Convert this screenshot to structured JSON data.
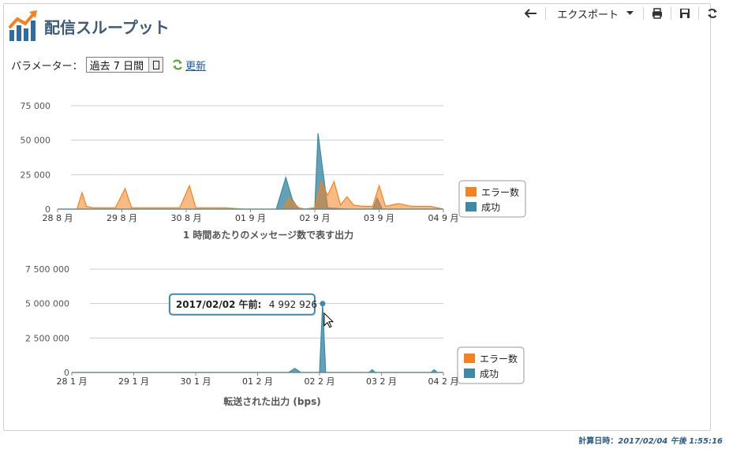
{
  "header": {
    "title": "配信スループット"
  },
  "toolbar": {
    "export_label": "エクスポート"
  },
  "params": {
    "label": "パラメーター：",
    "value": "過去 7 日間",
    "refresh_label": "更新"
  },
  "charts": [
    {
      "caption": "1 時間あたりのメッセージ数で表す出力",
      "y_ticks": [
        "75 000",
        "50 000",
        "25 000",
        "0"
      ],
      "x_ticks": [
        "28 8 月",
        "29 8 月",
        "30 8 月",
        "01 9 月",
        "02 9 月",
        "03 9 月",
        "04 9 月"
      ],
      "legend": [
        "エラー数",
        "成功"
      ]
    },
    {
      "caption": "転送された出力 (bps)",
      "y_ticks": [
        "7 500 000",
        "5 000 000",
        "2 500 000",
        "0"
      ],
      "x_ticks": [
        "28 1 月",
        "29 1 月",
        "30 1 月",
        "01 2 月",
        "02 2 月",
        "03 2 月",
        "04 2 月"
      ],
      "legend": [
        "エラー数",
        "成功"
      ],
      "tooltip": {
        "label": "2017/02/02 午前:",
        "value": "4 992 926"
      }
    }
  ],
  "footer": {
    "label": "計算日時：",
    "value": "2017/02/04 午後 1:55:16"
  },
  "colors": {
    "error": "#f5821f",
    "success": "#3c8aa6",
    "grid": "#cccccc",
    "title": "#3e5a7a"
  },
  "chart_data": [
    {
      "type": "area",
      "title": "1 時間あたりのメッセージ数で表す出力",
      "categories": [
        "28 8 月",
        "29 8 月",
        "30 8 月",
        "01 9 月",
        "02 9 月",
        "03 9 月",
        "04 9 月"
      ],
      "ylim": [
        0,
        75000
      ],
      "legend_position": "right",
      "series": [
        {
          "name": "エラー数",
          "color": "#f5821f",
          "x": [
            0,
            0.3,
            0.38,
            0.45,
            0.55,
            0.9,
            1.05,
            1.15,
            1.3,
            1.6,
            1.9,
            2.05,
            2.15,
            2.3,
            2.6,
            2.9,
            3.0,
            3.2,
            3.5,
            3.6,
            3.75,
            3.85,
            4.0,
            4.1,
            4.2,
            4.3,
            4.4,
            4.5,
            4.6,
            4.75,
            4.9,
            5.0,
            5.1,
            5.3,
            5.5,
            5.8,
            6.0
          ],
          "y": [
            0,
            0,
            12000,
            2000,
            1000,
            1000,
            15000,
            1000,
            1000,
            1000,
            1000,
            17000,
            1000,
            1000,
            1000,
            0,
            0,
            0,
            0,
            8000,
            1000,
            0,
            1000,
            20000,
            10000,
            20000,
            3000,
            9000,
            3000,
            2000,
            2000,
            17000,
            2000,
            4000,
            2000,
            2000,
            0
          ]
        },
        {
          "name": "成功",
          "color": "#3c8aa6",
          "x": [
            0,
            3.4,
            3.55,
            3.65,
            3.75,
            3.85,
            4.0,
            4.05,
            4.2,
            4.5,
            4.9,
            4.97,
            5.05,
            6.0
          ],
          "y": [
            0,
            0,
            23000,
            7000,
            0,
            0,
            1000,
            55000,
            1000,
            0,
            0,
            8000,
            0,
            0
          ]
        }
      ]
    },
    {
      "type": "area",
      "title": "転送された出力 (bps)",
      "categories": [
        "28 1 月",
        "29 1 月",
        "30 1 月",
        "01 2 月",
        "02 2 月",
        "03 2 月",
        "04 2 月"
      ],
      "ylim": [
        0,
        7500000
      ],
      "legend_position": "right",
      "series": [
        {
          "name": "エラー数",
          "color": "#f5821f",
          "x": [
            0,
            6.0
          ],
          "y": [
            0,
            0
          ]
        },
        {
          "name": "成功",
          "color": "#3c8aa6",
          "x": [
            0,
            0.8,
            1.0,
            1.2,
            3.5,
            3.6,
            3.7,
            4.0,
            4.05,
            4.1,
            4.2,
            4.8,
            4.85,
            4.9,
            5.8,
            5.85,
            5.9,
            6.0
          ],
          "y": [
            0,
            0,
            0,
            0,
            0,
            300000,
            0,
            0,
            4992926,
            0,
            0,
            0,
            200000,
            0,
            0,
            200000,
            0,
            0
          ]
        }
      ]
    }
  ]
}
